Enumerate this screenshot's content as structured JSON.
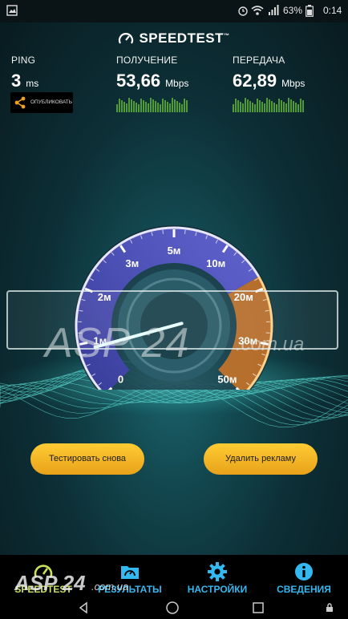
{
  "status_bar": {
    "battery": "63%",
    "time": "0:14"
  },
  "app_title": "SPEEDTEST",
  "metrics": {
    "ping": {
      "label": "PING",
      "value": "3",
      "unit": "ms"
    },
    "download": {
      "label": "ПОЛУЧЕНИЕ",
      "value": "53,66",
      "unit": "Mbps"
    },
    "upload": {
      "label": "ПЕРЕДАЧА",
      "value": "62,89",
      "unit": "Mbps"
    }
  },
  "share_label": "ОПУБЛИКОВАТЬ",
  "gauge": {
    "ticks": [
      "0",
      "1м",
      "2м",
      "3м",
      "5м",
      "10м",
      "20м",
      "30м",
      "50м"
    ],
    "needle_level": 0.11
  },
  "watermark": {
    "text": "ASP 24",
    "domain": ".com.ua"
  },
  "buttons": {
    "retest": "Тестировать снова",
    "remove_ads": "Удалить рекламу"
  },
  "tabs": [
    {
      "label": "SPEEDTEST",
      "icon": "speedometer-icon"
    },
    {
      "label": "РЕЗУЛЬТАТЫ",
      "icon": "results-icon"
    },
    {
      "label": "НАСТРОЙКИ",
      "icon": "gear-icon"
    },
    {
      "label": "СВЕДЕНИЯ",
      "icon": "info-icon"
    }
  ],
  "bottom_watermark": {
    "text": "ASP 24",
    "domain": ".com.ua"
  },
  "colors": {
    "accent_active": "#c8e05a",
    "tab_blue": "#34b8f0",
    "button": "#f5b428",
    "gauge_blue": "#6a5ad8",
    "gauge_orange": "#d4781e"
  }
}
